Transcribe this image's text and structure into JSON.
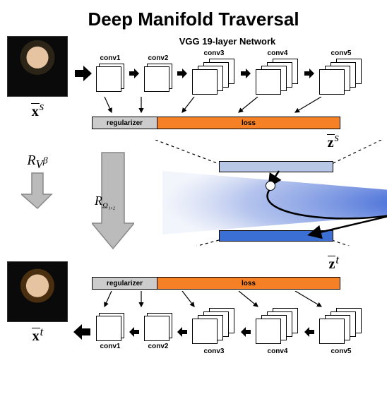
{
  "title": "Deep Manifold Traversal",
  "subtitle": "VGG 19-layer Network",
  "images": {
    "input_label": "x̄",
    "output_label": "x̄",
    "input_sup": "s",
    "output_sup": "t"
  },
  "conv_labels": {
    "c1": "conv1",
    "c2": "conv2",
    "c3": "conv3",
    "c4": "conv4",
    "c5": "conv5"
  },
  "bar": {
    "reg": "regularizer",
    "loss": "loss"
  },
  "z_labels": {
    "zs_base": "z̄",
    "zs_sup": "s",
    "zt_base": "z̄",
    "zt_sup": "t"
  },
  "arrows": {
    "down_label_base": "R",
    "down_label_sub": "Ω₁,₂",
    "side_label_base": "R",
    "side_label_sub": "V",
    "side_label_sup": "β"
  }
}
